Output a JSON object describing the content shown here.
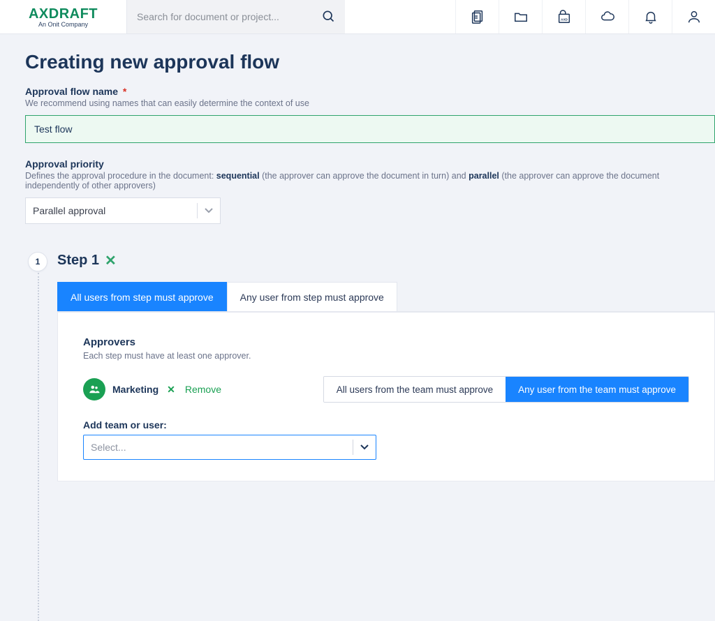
{
  "header": {
    "brand": "AXDRAFT",
    "tagline": "An Onit Company",
    "search_placeholder": "Search for document or project..."
  },
  "page_title": "Creating new approval flow",
  "name_field": {
    "label": "Approval flow name",
    "hint": "We recommend using names that can easily determine the context of use",
    "value": "Test flow"
  },
  "priority_field": {
    "label": "Approval priority",
    "hint_pre": "Defines the approval procedure in the document: ",
    "seq_word": "sequential",
    "hint_mid": " (the approver can approve the document in turn) and ",
    "par_word": "parallel",
    "hint_post": " (the approver can approve the document independently of other approvers)",
    "value": "Parallel approval"
  },
  "step": {
    "index": "1",
    "title": "Step 1",
    "tab_all": "All users from step must approve",
    "tab_any": "Any user from step must approve",
    "approvers_title": "Approvers",
    "approvers_hint": "Each step must have at least one approver.",
    "team_name": "Marketing",
    "remove_label": "Remove",
    "rule_all": "All users from the team must approve",
    "rule_any": "Any user from the team must approve",
    "add_label": "Add team or user:",
    "select_placeholder": "Select..."
  }
}
